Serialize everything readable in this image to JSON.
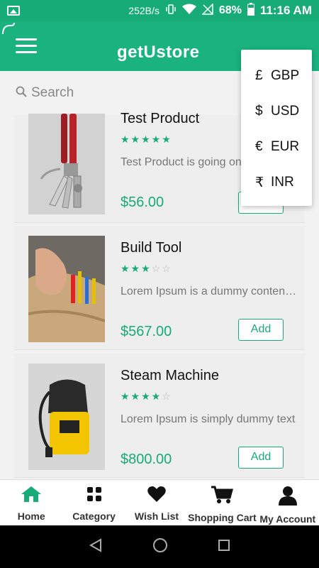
{
  "status_bar": {
    "speed": "252B/s",
    "battery": "68%",
    "time": "11:16 AM"
  },
  "header": {
    "logo_text_left": "get",
    "logo_text_u": "U",
    "logo_text_right": "store"
  },
  "search": {
    "placeholder": "Search"
  },
  "currency_menu": {
    "items": [
      {
        "symbol": "£",
        "code": "GBP"
      },
      {
        "symbol": "$",
        "code": "USD"
      },
      {
        "symbol": "€",
        "code": "EUR"
      },
      {
        "symbol": "₹",
        "code": "INR"
      }
    ]
  },
  "products": [
    {
      "title": "Test Product",
      "rating": 5,
      "description": "Test Product is going on sale",
      "price": "$56.00",
      "add_label": "Add"
    },
    {
      "title": "Build Tool",
      "rating": 3,
      "description": "Lorem Ipsum is a dummy content text",
      "price": "$567.00",
      "add_label": "Add"
    },
    {
      "title": "Steam Machine",
      "rating": 4,
      "description": "Lorem Ipsum is simply dummy text",
      "price": "$800.00",
      "add_label": "Add"
    }
  ],
  "bottom_nav": {
    "items": [
      {
        "label": "Home",
        "icon": "home-icon"
      },
      {
        "label": "Category",
        "icon": "category-icon"
      },
      {
        "label": "Wish List",
        "icon": "heart-icon"
      },
      {
        "label": "Shopping Cart",
        "icon": "cart-icon"
      },
      {
        "label": "My Account",
        "icon": "account-icon"
      }
    ]
  },
  "colors": {
    "brand": "#1ab27f",
    "accent": "#17ab78"
  }
}
